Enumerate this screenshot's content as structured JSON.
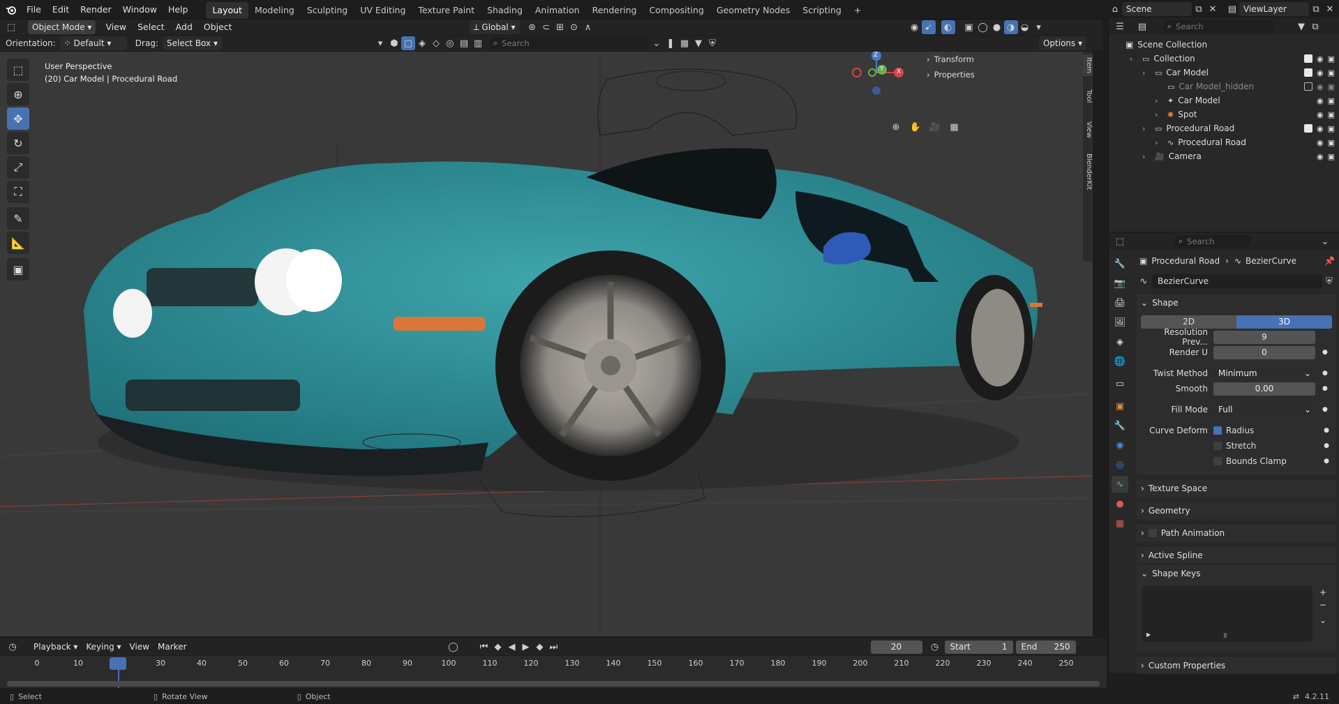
{
  "app": {
    "menus": [
      "File",
      "Edit",
      "Render",
      "Window",
      "Help"
    ],
    "workspaces": [
      "Layout",
      "Modeling",
      "Sculpting",
      "UV Editing",
      "Texture Paint",
      "Shading",
      "Animation",
      "Rendering",
      "Compositing",
      "Geometry Nodes",
      "Scripting"
    ],
    "active_workspace": "Layout",
    "add_workspace": "+",
    "scene": "Scene",
    "view_layer": "ViewLayer"
  },
  "viewport_header": {
    "mode": "Object Mode",
    "menus": [
      "View",
      "Select",
      "Add",
      "Object"
    ],
    "transform_orientation": "Global"
  },
  "tool_settings": {
    "orientation_label": "Orientation:",
    "orientation_value": "Default",
    "drag_label": "Drag:",
    "drag_value": "Select Box",
    "search_placeholder": "Search",
    "options_label": "Options"
  },
  "viewport": {
    "perspective": "User Perspective",
    "object_info": "(20) Car Model | Procedural Road",
    "n_panel": {
      "transform": "Transform",
      "properties": "Properties"
    },
    "side_tabs": [
      "Item",
      "Tool",
      "View",
      "BlenderKit"
    ],
    "gizmo": {
      "z": "Z",
      "y": "Y",
      "x": "X"
    }
  },
  "outliner": {
    "search_placeholder": "Search",
    "root": "Scene Collection",
    "items": [
      {
        "label": "Collection",
        "indent": 1
      },
      {
        "label": "Car Model",
        "indent": 2
      },
      {
        "label": "Car Model_hidden",
        "indent": 3
      },
      {
        "label": "Car Model",
        "indent": 3
      },
      {
        "label": "Spot",
        "indent": 3
      },
      {
        "label": "Procedural Road",
        "indent": 2
      },
      {
        "label": "Procedural Road",
        "indent": 3
      },
      {
        "label": "Camera",
        "indent": 2
      }
    ]
  },
  "properties": {
    "search_placeholder": "Search",
    "breadcrumb_object": "Procedural Road",
    "breadcrumb_data": "BezierCurve",
    "datablock_name": "BezierCurve",
    "shape_panel": "Shape",
    "dim_2d": "2D",
    "dim_3d": "3D",
    "resolution_preview_label": "Resolution Prev...",
    "resolution_preview_value": "9",
    "render_u_label": "Render U",
    "render_u_value": "0",
    "twist_method_label": "Twist Method",
    "twist_method_value": "Minimum",
    "smooth_label": "Smooth",
    "smooth_value": "0.00",
    "fill_mode_label": "Fill Mode",
    "fill_mode_value": "Full",
    "curve_deform_label": "Curve Deform",
    "radius_label": "Radius",
    "stretch_label": "Stretch",
    "bounds_clamp_label": "Bounds Clamp",
    "panels": [
      "Texture Space",
      "Geometry",
      "Path Animation",
      "Active Spline"
    ],
    "shape_keys": "Shape Keys",
    "custom_properties": "Custom Properties"
  },
  "timeline": {
    "menus": [
      "Playback",
      "Keying",
      "View",
      "Marker"
    ],
    "current_frame": "20",
    "start_label": "Start",
    "start_value": "1",
    "end_label": "End",
    "end_value": "250",
    "ticks": [
      "0",
      "10",
      "20",
      "30",
      "40",
      "50",
      "60",
      "70",
      "80",
      "90",
      "100",
      "110",
      "120",
      "130",
      "140",
      "150",
      "160",
      "170",
      "180",
      "190",
      "200",
      "210",
      "220",
      "230",
      "240",
      "250"
    ]
  },
  "statusbar": {
    "select": "Select",
    "rotate": "Rotate View",
    "object": "Object",
    "version": "4.2.11"
  },
  "colors": {
    "accent": "#4772b3",
    "car_body": "#2a8a94",
    "viewport_bg": "#393939",
    "frame_marker": "#4772b3"
  }
}
